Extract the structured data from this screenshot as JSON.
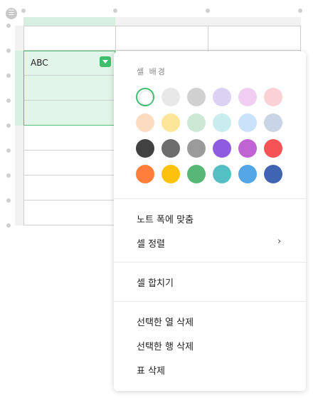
{
  "table_menu_icon": "table-handle-icon",
  "table": {
    "selected_cell_text": "ABC"
  },
  "menu": {
    "section_title": "셀 배경",
    "colors": [
      [
        "#ffffff",
        "#e8e8e8",
        "#d0d0d0",
        "#dcd1f3",
        "#f1cdf2",
        "#fbd0d6"
      ],
      [
        "#fddbc0",
        "#fde59a",
        "#cde9d6",
        "#c9ecef",
        "#cbe3fa",
        "#c9d5e6"
      ],
      [
        "#414141",
        "#6d6d6d",
        "#9b9b9b",
        "#8e5be1",
        "#c063d3",
        "#f55356"
      ],
      [
        "#ff7e3b",
        "#ffc20c",
        "#57b776",
        "#55c0c4",
        "#54a6e6",
        "#3f64b2"
      ]
    ],
    "selected_color": "#ffffff",
    "items": {
      "fit_width": "노트 폭에 맞춤",
      "cell_align": "셀 정렬",
      "merge": "셀 합치기",
      "delete_col": "선택한 열 삭제",
      "delete_row": "선택한 행 삭제",
      "delete_table": "표 삭제"
    }
  }
}
